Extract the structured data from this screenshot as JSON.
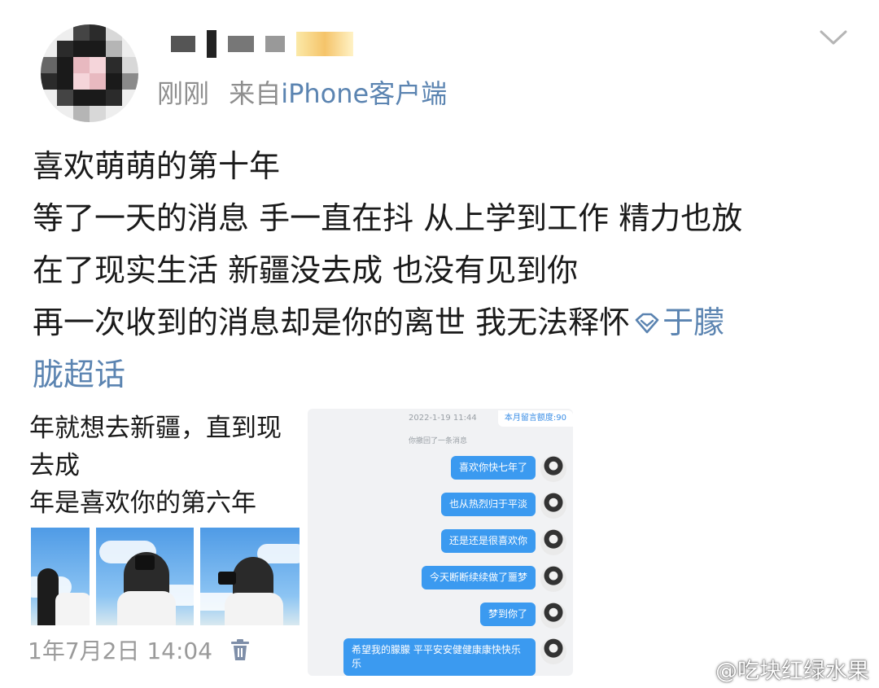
{
  "header": {
    "meta_time": "刚刚",
    "meta_from": "来自",
    "meta_source": "iPhone客户端"
  },
  "post": {
    "lines": [
      "喜欢萌萌的第十年",
      "等了一天的消息 手一直在抖 从上学到工作 精力也放",
      "在了现实生活  新疆没去成 也没有见到你",
      "再一次收到的消息却是你的离世 我无法释怀"
    ],
    "topic_part1": "于朦",
    "topic_part2": "胧超话"
  },
  "left_screenshot": {
    "lines": [
      "年就想去新疆，直到现",
      "去成",
      "年是喜欢你的第六年"
    ],
    "date": "1年7月2日 14:04"
  },
  "chat": {
    "timestamp": "2022-1-19 11:44",
    "quota": "本月留言额度:90",
    "system_note": "你撤回了一条消息",
    "messages": [
      "喜欢你快七年了",
      "也从热烈归于平淡",
      "还是还是很喜欢你",
      "今天断断续续做了噩梦",
      "梦到你了",
      "希望我的朦朦 平平安安健健康康快快乐乐"
    ]
  },
  "watermark": "@吃块红绿水果",
  "colors": {
    "link_blue": "#5b84b1",
    "meta_gray": "#8e8e8e",
    "bubble_blue": "#3b9af0"
  }
}
